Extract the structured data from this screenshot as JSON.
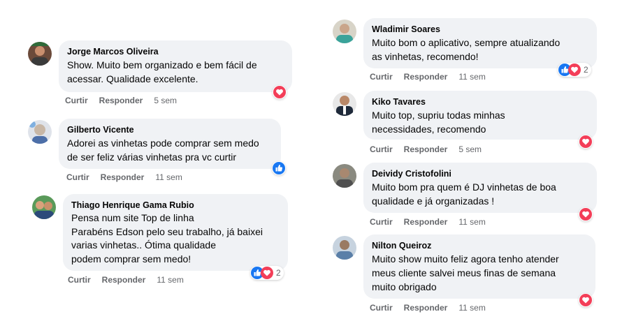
{
  "colors": {
    "like": "#1877f2",
    "love": "#f33e58",
    "bubble": "#f0f2f5",
    "meta": "#65676b"
  },
  "comments": [
    {
      "name": "Jorge Marcos Oliveira",
      "lines": [
        "Show. Muito bem organizado e bem fácil de",
        "acessar. Qualidade excelente."
      ],
      "like": "Curtir",
      "reply": "Responder",
      "time": "5 sem",
      "reactions": [
        "love"
      ],
      "count": ""
    },
    {
      "name": "Gilberto Vicente",
      "lines": [
        "Adorei as vinhetas pode comprar sem medo",
        "de ser feliz várias vinhetas pra vc curtir"
      ],
      "like": "Curtir",
      "reply": "Responder",
      "time": "11 sem",
      "reactions": [
        "like"
      ],
      "count": ""
    },
    {
      "name": "Thiago Henrique Gama Rubio",
      "lines": [
        "Pensa num site Top de linha",
        "Parabéns Edson pelo seu trabalho, já baixei",
        "varias vinhetas.. Ótima qualidade",
        "podem comprar sem medo!"
      ],
      "like": "Curtir",
      "reply": "Responder",
      "time": "11 sem",
      "reactions": [
        "like",
        "love"
      ],
      "count": "2"
    },
    {
      "name": "Wladimir Soares",
      "lines": [
        "Muito bom o aplicativo, sempre atualizando",
        "as vinhetas, recomendo!"
      ],
      "like": "Curtir",
      "reply": "Responder",
      "time": "11 sem",
      "reactions": [
        "like",
        "love"
      ],
      "count": "2"
    },
    {
      "name": "Kiko Tavares",
      "lines": [
        "Muito top, supriu todas minhas",
        "necessidades, recomendo"
      ],
      "like": "Curtir",
      "reply": "Responder",
      "time": "5 sem",
      "reactions": [
        "love"
      ],
      "count": ""
    },
    {
      "name": "Deividy Cristofolini",
      "lines": [
        "Muito bom pra quem é DJ vinhetas de boa",
        "qualidade e já organizadas !"
      ],
      "like": "Curtir",
      "reply": "Responder",
      "time": "11 sem",
      "reactions": [
        "love"
      ],
      "count": ""
    },
    {
      "name": "Nilton Queiroz",
      "lines": [
        "Muito show muito feliz agora tenho atender",
        "meus cliente salvei meus finas de semana",
        "muito obrigado"
      ],
      "like": "Curtir",
      "reply": "Responder",
      "time": "11 sem",
      "reactions": [
        "love"
      ],
      "count": ""
    }
  ]
}
